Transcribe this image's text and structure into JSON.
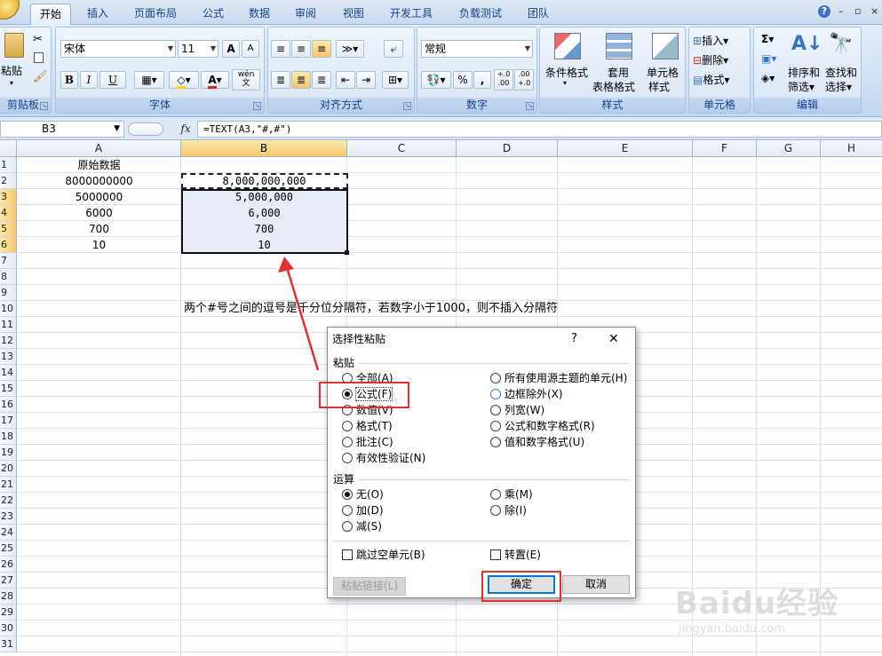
{
  "ribbon_tabs": [
    "开始",
    "插入",
    "页面布局",
    "公式",
    "数据",
    "审阅",
    "视图",
    "开发工具",
    "负载测试",
    "团队"
  ],
  "window_controls": {
    "help": "?",
    "minimize": "–",
    "restore": "▫",
    "close": "×"
  },
  "clipboard": {
    "paste": "粘贴",
    "title": "剪贴板"
  },
  "font": {
    "name": "宋体",
    "size": "11",
    "bold": "B",
    "italic": "I",
    "underline": "U",
    "grow": "A",
    "shrink": "A",
    "wen": "wén\n文",
    "title": "字体"
  },
  "alignment": {
    "title": "对齐方式"
  },
  "number": {
    "format": "常规",
    "percent": "%",
    "comma": ",",
    "inc": "+.0\n.00",
    "dec": ".00\n+.0",
    "title": "数字"
  },
  "styles": {
    "cond": "条件格式",
    "table_1": "套用",
    "table_2": "表格格式",
    "cell_1": "单元格",
    "cell_2": "样式",
    "title": "样式"
  },
  "cells_group": {
    "insert": "插入",
    "delete": "删除",
    "format": "格式",
    "title": "单元格"
  },
  "editing": {
    "sigma": "Σ",
    "sort_1": "排序和",
    "sort_2": "筛选",
    "find_1": "查找和",
    "find_2": "选择",
    "title": "编辑"
  },
  "formula_bar": {
    "name_box": "B3",
    "fx": "fx",
    "formula": "=TEXT(A3,\"#,#\")"
  },
  "columns": [
    "A",
    "B",
    "C",
    "D",
    "E",
    "F",
    "G",
    "H"
  ],
  "rows": [
    "1",
    "2",
    "3",
    "4",
    "5",
    "6",
    "7",
    "8",
    "9",
    "10",
    "11",
    "12",
    "13",
    "14",
    "15",
    "16",
    "17",
    "18",
    "19",
    "20",
    "21",
    "22",
    "23",
    "24",
    "25",
    "26",
    "27",
    "28",
    "29",
    "30",
    "31"
  ],
  "cells": {
    "A1": "原始数据",
    "A2": "8000000000",
    "A3": "5000000",
    "A4": "6000",
    "A5": "700",
    "A6": "10",
    "B2": "8,000,000,000",
    "B3": "5,000,000",
    "B4": "6,000",
    "B5": "700",
    "B6": "10",
    "B10": "两个#号之间的逗号是千分位分隔符，若数字小于1000，则不插入分隔符"
  },
  "dialog": {
    "title": "选择性粘贴",
    "help": "?",
    "close": "✕",
    "paste_section": "粘贴",
    "paste_left": [
      "全部(A)",
      "公式(F)",
      "数值(V)",
      "格式(T)",
      "批注(C)",
      "有效性验证(N)"
    ],
    "paste_right": [
      "所有使用源主题的单元(H)",
      "边框除外(X)",
      "列宽(W)",
      "公式和数字格式(R)",
      "值和数字格式(U)"
    ],
    "op_section": "运算",
    "op_left": [
      "无(O)",
      "加(D)",
      "减(S)"
    ],
    "op_right": [
      "乘(M)",
      "除(I)"
    ],
    "skip_blanks": "跳过空单元(B)",
    "transpose": "转置(E)",
    "paste_link": "粘贴链接(L)",
    "ok": "确定",
    "cancel": "取消"
  },
  "watermark": {
    "text": "Baidu经验",
    "sub": "jingyan.baidu.com"
  },
  "colors": {
    "annotation_red": "#e03030",
    "ribbon_blue": "#15428b",
    "selected_header": "#f5c76b"
  }
}
